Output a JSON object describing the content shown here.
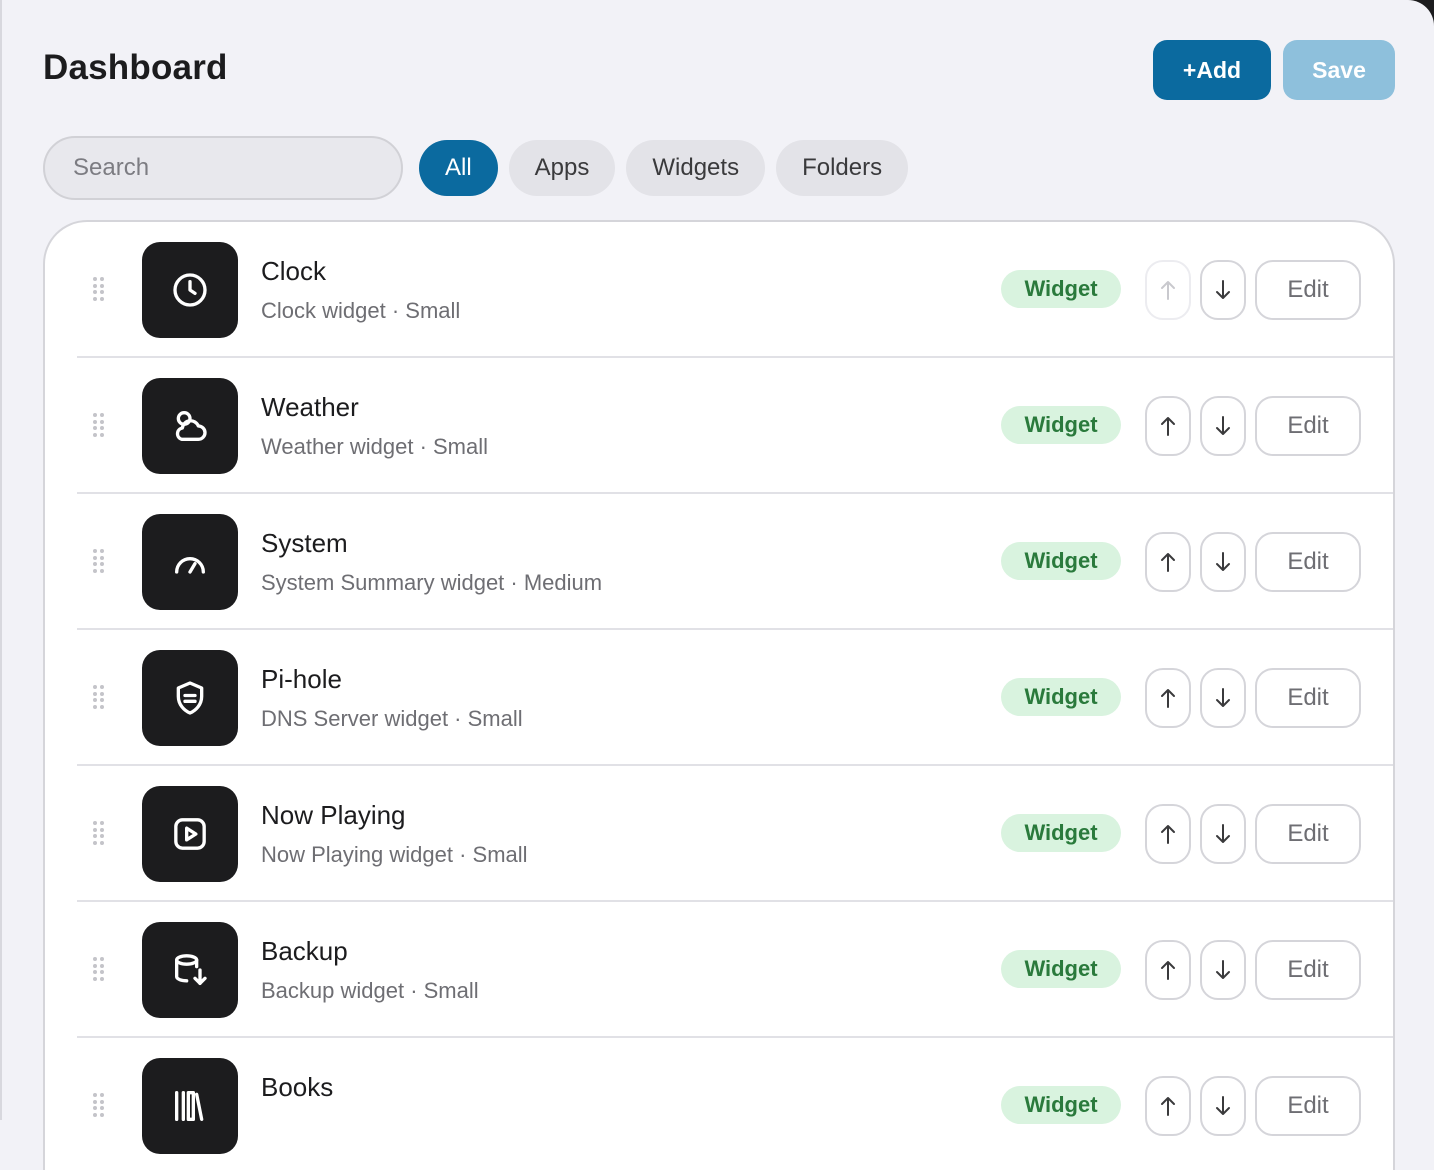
{
  "header": {
    "title": "Dashboard",
    "add_label": "+Add",
    "save_label": "Save"
  },
  "search": {
    "placeholder": "Search",
    "value": ""
  },
  "filters": [
    {
      "label": "All",
      "active": true
    },
    {
      "label": "Apps",
      "active": false
    },
    {
      "label": "Widgets",
      "active": false
    },
    {
      "label": "Folders",
      "active": false
    }
  ],
  "colors": {
    "accent": "#0b6a9f",
    "save_disabled": "#8ec0dc",
    "badge_bg": "#d9f3df",
    "badge_text": "#2a7a3c",
    "icon_tile": "#1c1c1e"
  },
  "items": [
    {
      "title": "Clock",
      "subtitle": "Clock widget · Small",
      "badge": "Widget",
      "icon": "clock-icon",
      "edit_label": "Edit",
      "up_disabled": true
    },
    {
      "title": "Weather",
      "subtitle": "Weather widget · Small",
      "badge": "Widget",
      "icon": "cloud-icon",
      "edit_label": "Edit",
      "up_disabled": false
    },
    {
      "title": "System",
      "subtitle": "System Summary widget · Medium",
      "badge": "Widget",
      "icon": "gauge-icon",
      "edit_label": "Edit",
      "up_disabled": false
    },
    {
      "title": "Pi-hole",
      "subtitle": "DNS Server widget · Small",
      "badge": "Widget",
      "icon": "shield-icon",
      "edit_label": "Edit",
      "up_disabled": false
    },
    {
      "title": "Now Playing",
      "subtitle": "Now Playing widget · Small",
      "badge": "Widget",
      "icon": "play-icon",
      "edit_label": "Edit",
      "up_disabled": false
    },
    {
      "title": "Backup",
      "subtitle": "Backup widget · Small",
      "badge": "Widget",
      "icon": "database-download-icon",
      "edit_label": "Edit",
      "up_disabled": false
    },
    {
      "title": "Books",
      "subtitle": "",
      "badge": "Widget",
      "icon": "books-icon",
      "edit_label": "Edit",
      "up_disabled": false
    }
  ]
}
